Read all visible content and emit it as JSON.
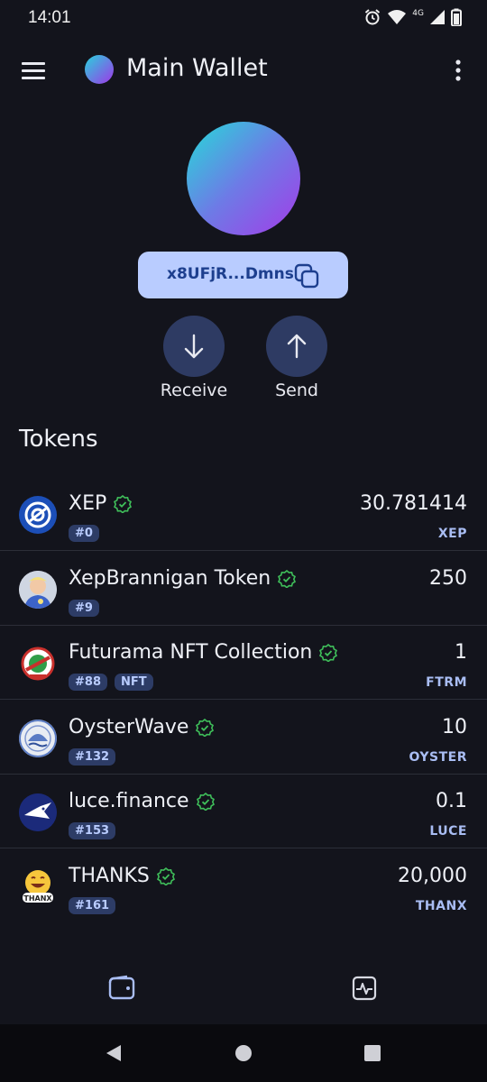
{
  "status": {
    "time": "14:01",
    "network": "4G"
  },
  "header": {
    "title": "Main Wallet"
  },
  "address": {
    "short": "x8UFjR...Dmns"
  },
  "actions": {
    "receive": "Receive",
    "send": "Send"
  },
  "tokens_title": "Tokens",
  "tokens": [
    {
      "name": "XEP",
      "badges": [
        "#0"
      ],
      "amount": "30.781414",
      "symbol": "XEP"
    },
    {
      "name": "XepBrannigan Token",
      "badges": [
        "#9"
      ],
      "amount": "250",
      "symbol": ""
    },
    {
      "name": "Futurama NFT Collection",
      "badges": [
        "#88",
        "NFT"
      ],
      "amount": "1",
      "symbol": "FTRM"
    },
    {
      "name": "OysterWave",
      "badges": [
        "#132"
      ],
      "amount": "10",
      "symbol": "OYSTER"
    },
    {
      "name": "luce.finance",
      "badges": [
        "#153"
      ],
      "amount": "0.1",
      "symbol": "LUCE"
    },
    {
      "name": "THANKS",
      "badges": [
        "#161"
      ],
      "amount": "20,000",
      "symbol": "THANX"
    }
  ],
  "logo_text": {
    "thanks": "THANX"
  },
  "colors": {
    "background": "#13141c",
    "chip": "#b9ccff",
    "action": "#2e3b63",
    "verified": "#3fbf5a",
    "badge": "#2d3c66"
  }
}
